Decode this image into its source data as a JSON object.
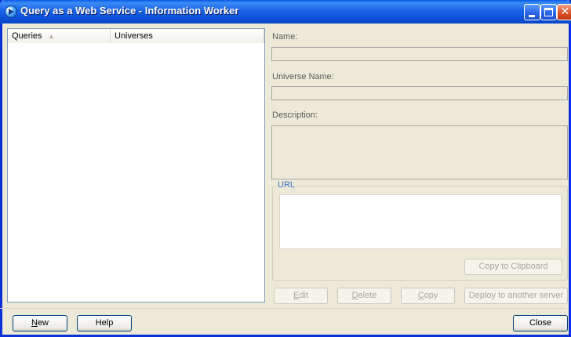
{
  "window": {
    "title": "Query as a Web Service - Information Worker"
  },
  "list": {
    "columns": [
      {
        "label": "Queries"
      },
      {
        "label": "Universes"
      }
    ],
    "sort_icon": "▲"
  },
  "details": {
    "name_label": "Name:",
    "name_value": "",
    "universe_label": "Universe Name:",
    "universe_value": "",
    "description_label": "Description:",
    "description_value": "",
    "url_group_label": "URL",
    "url_value": "",
    "copy_clipboard_label": "Copy to Clipboard"
  },
  "actions": {
    "edit": {
      "mnemonic": "E",
      "rest": "dit"
    },
    "delete": {
      "mnemonic": "D",
      "rest": "elete"
    },
    "copy": {
      "mnemonic": "C",
      "rest": "opy"
    },
    "deploy": "Deploy to another server"
  },
  "footer": {
    "new": {
      "mnemonic": "N",
      "rest": "ew"
    },
    "help": "Help",
    "close": "Close"
  },
  "colors": {
    "titlebar": "#0a5ae6",
    "frame": "#0831d9",
    "window_bg": "#ece9d8"
  },
  "icons": {
    "app": "app-icon",
    "minimize": "minimize-icon",
    "maximize": "maximize-icon",
    "close": "close-icon"
  }
}
